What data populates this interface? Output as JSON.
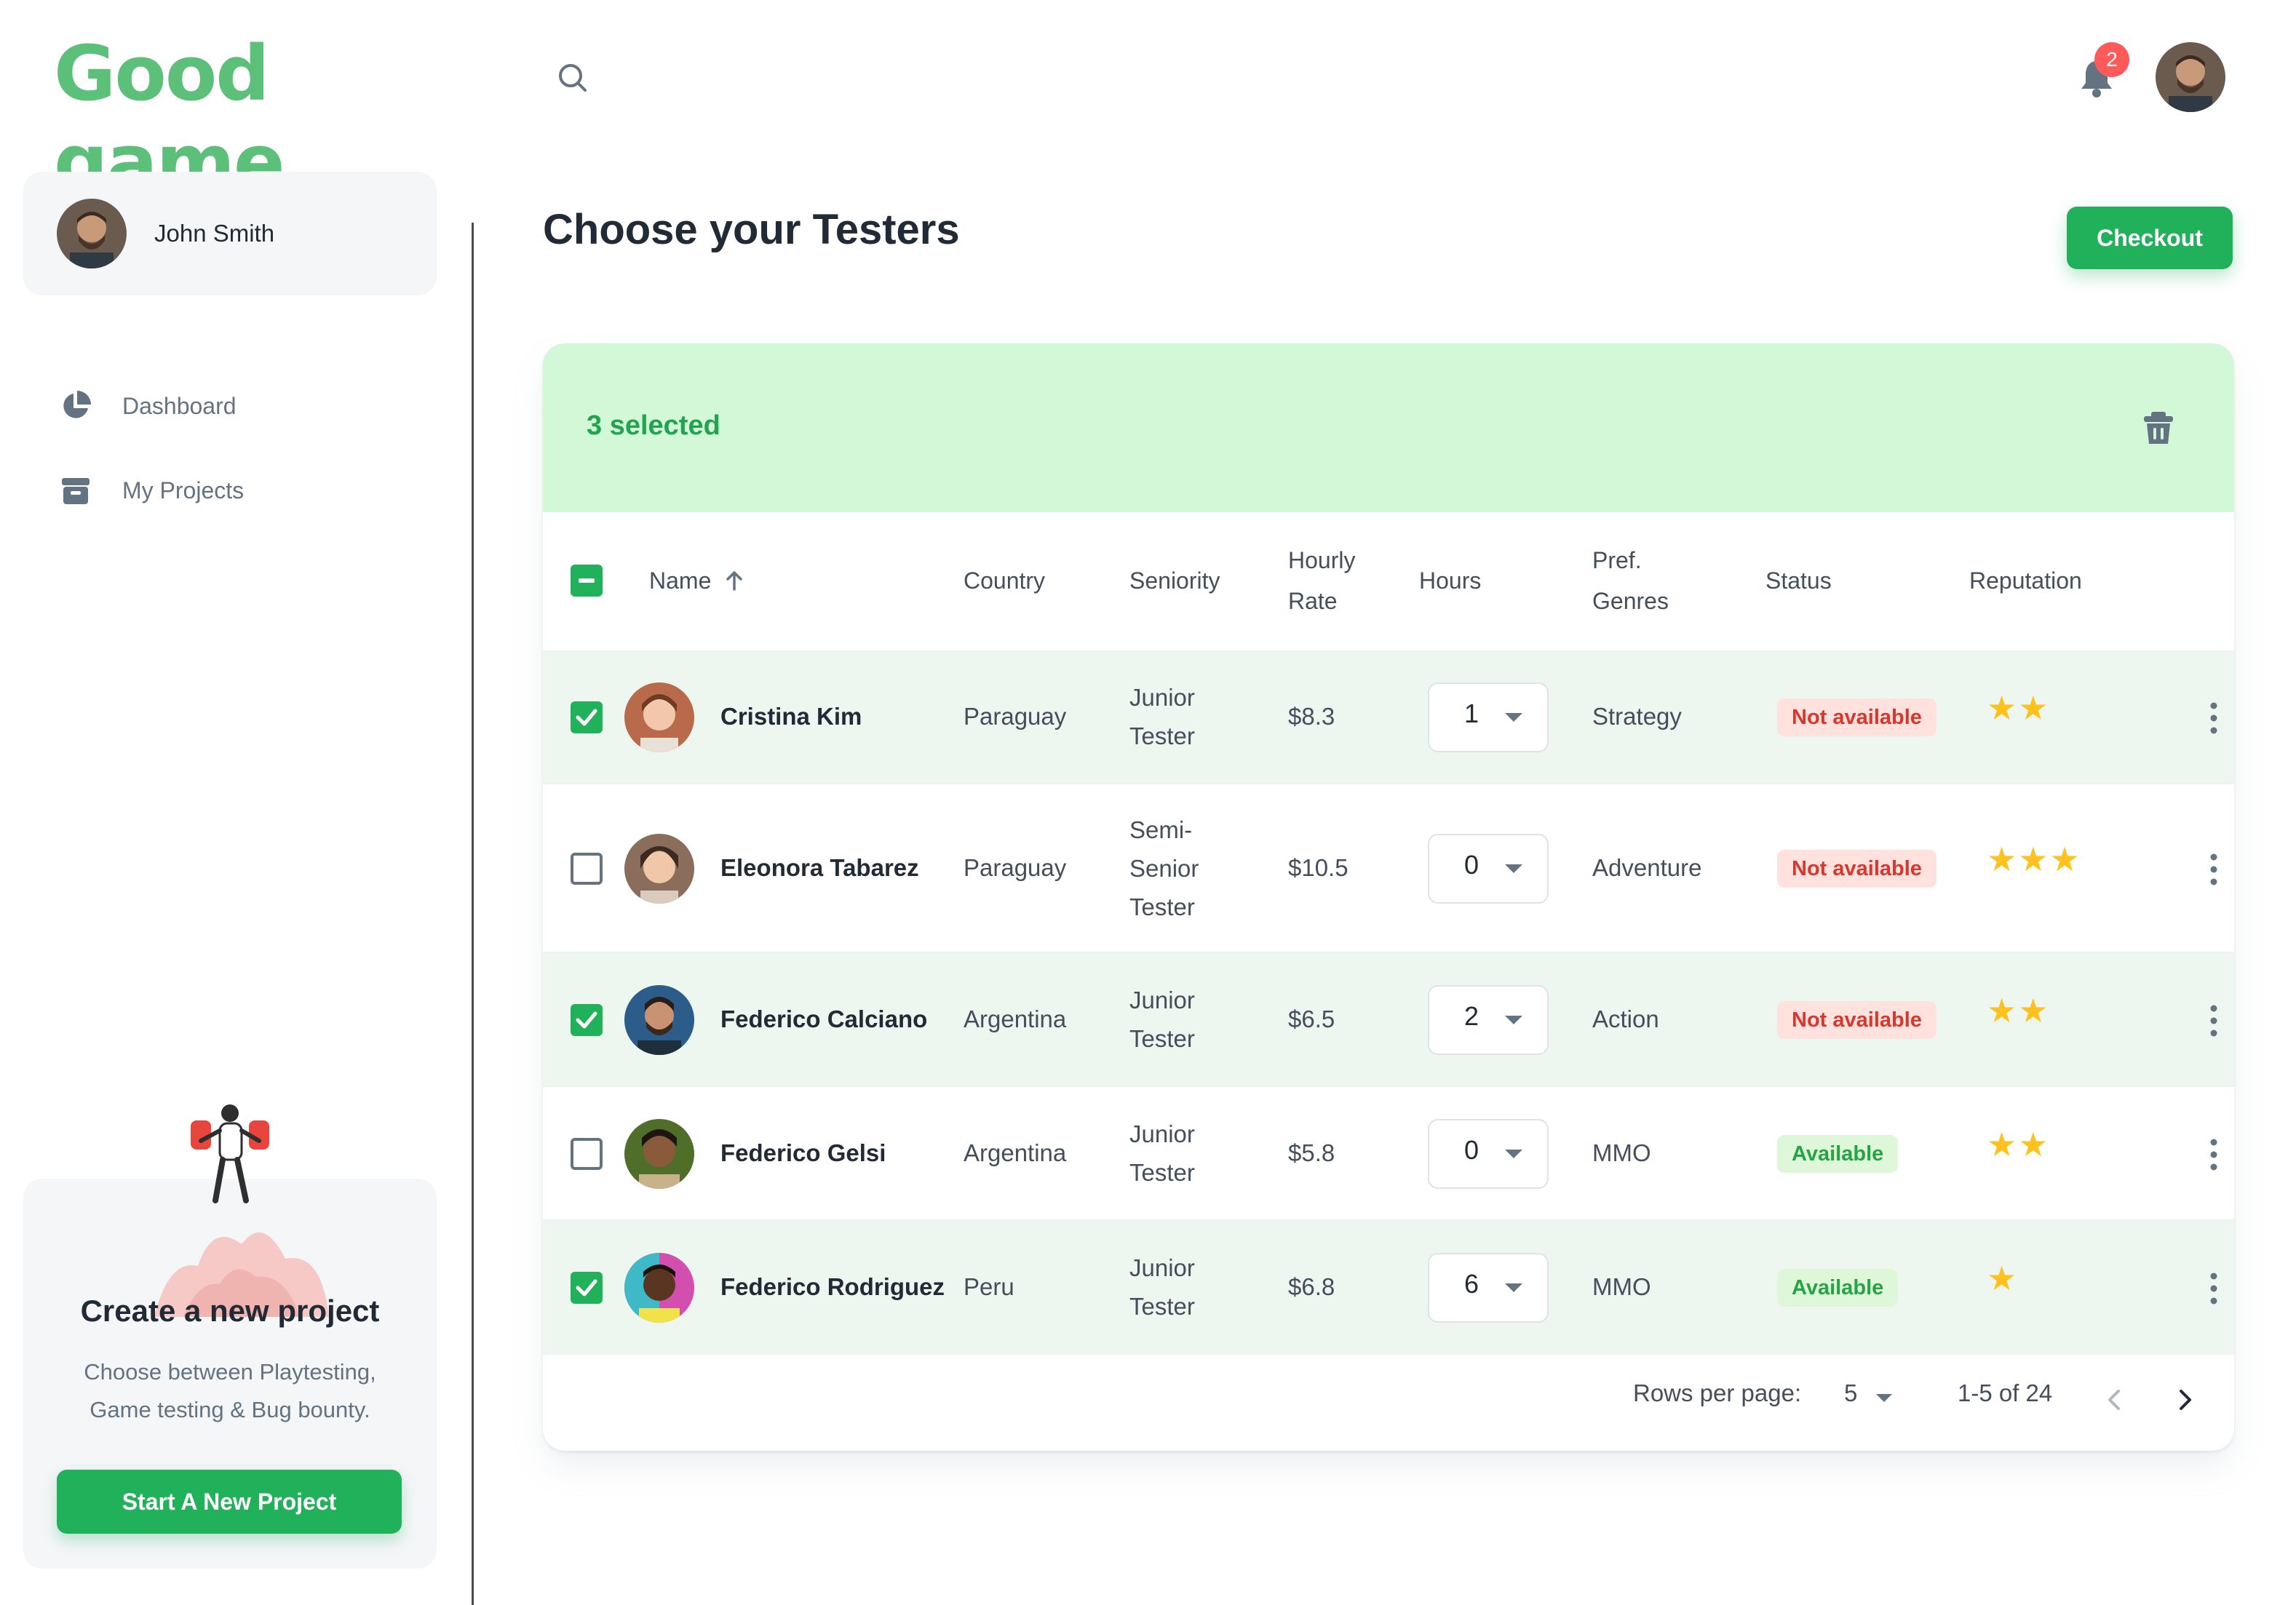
{
  "app": {
    "logo_text": "Good game",
    "brand_color": "#22b15b"
  },
  "user": {
    "name": "John Smith"
  },
  "nav": {
    "items": [
      {
        "label": "Dashboard",
        "icon": "pie-chart-icon"
      },
      {
        "label": "My Projects",
        "icon": "archive-icon"
      }
    ]
  },
  "promo": {
    "title": "Create a new project",
    "text_line1": "Choose between Playtesting,",
    "text_line2": "Game testing & Bug bounty.",
    "button_label": "Start A New Project"
  },
  "topbar": {
    "notification_count": "2"
  },
  "page": {
    "title": "Choose your Testers",
    "checkout_label": "Checkout"
  },
  "table": {
    "selected_text": "3 selected",
    "headers": {
      "name": "Name",
      "country": "Country",
      "seniority": "Seniority",
      "rate_line1": "Hourly",
      "rate_line2": "Rate",
      "hours": "Hours",
      "genres_line1": "Pref.",
      "genres_line2": "Genres",
      "status": "Status",
      "reputation": "Reputation"
    },
    "rows": [
      {
        "name": "Cristina Kim",
        "country": "Paraguay",
        "seniority": [
          "Junior",
          "Tester"
        ],
        "rate": "$8.3",
        "hours": "1",
        "genre": "Strategy",
        "status": "Not available",
        "stars": 2,
        "selected": true
      },
      {
        "name": "Eleonora Tabarez",
        "country": "Paraguay",
        "seniority": [
          "Semi-",
          "Senior",
          "Tester"
        ],
        "rate": "$10.5",
        "hours": "0",
        "genre": "Adventure",
        "status": "Not available",
        "stars": 3,
        "selected": false
      },
      {
        "name": "Federico Calciano",
        "country": "Argentina",
        "seniority": [
          "Junior",
          "Tester"
        ],
        "rate": "$6.5",
        "hours": "2",
        "genre": "Action",
        "status": "Not available",
        "stars": 2,
        "selected": true
      },
      {
        "name": "Federico Gelsi",
        "country": "Argentina",
        "seniority": [
          "Junior",
          "Tester"
        ],
        "rate": "$5.8",
        "hours": "0",
        "genre": "MMO",
        "status": "Available",
        "stars": 2,
        "selected": false
      },
      {
        "name": "Federico Rodriguez",
        "country": "Peru",
        "seniority": [
          "Junior",
          "Tester"
        ],
        "rate": "$6.8",
        "hours": "6",
        "genre": "MMO",
        "status": "Available",
        "stars": 1,
        "selected": true
      }
    ],
    "footer": {
      "rows_per_page_label": "Rows per page:",
      "rows_per_page": "5",
      "range": "1-5 of 24"
    }
  }
}
